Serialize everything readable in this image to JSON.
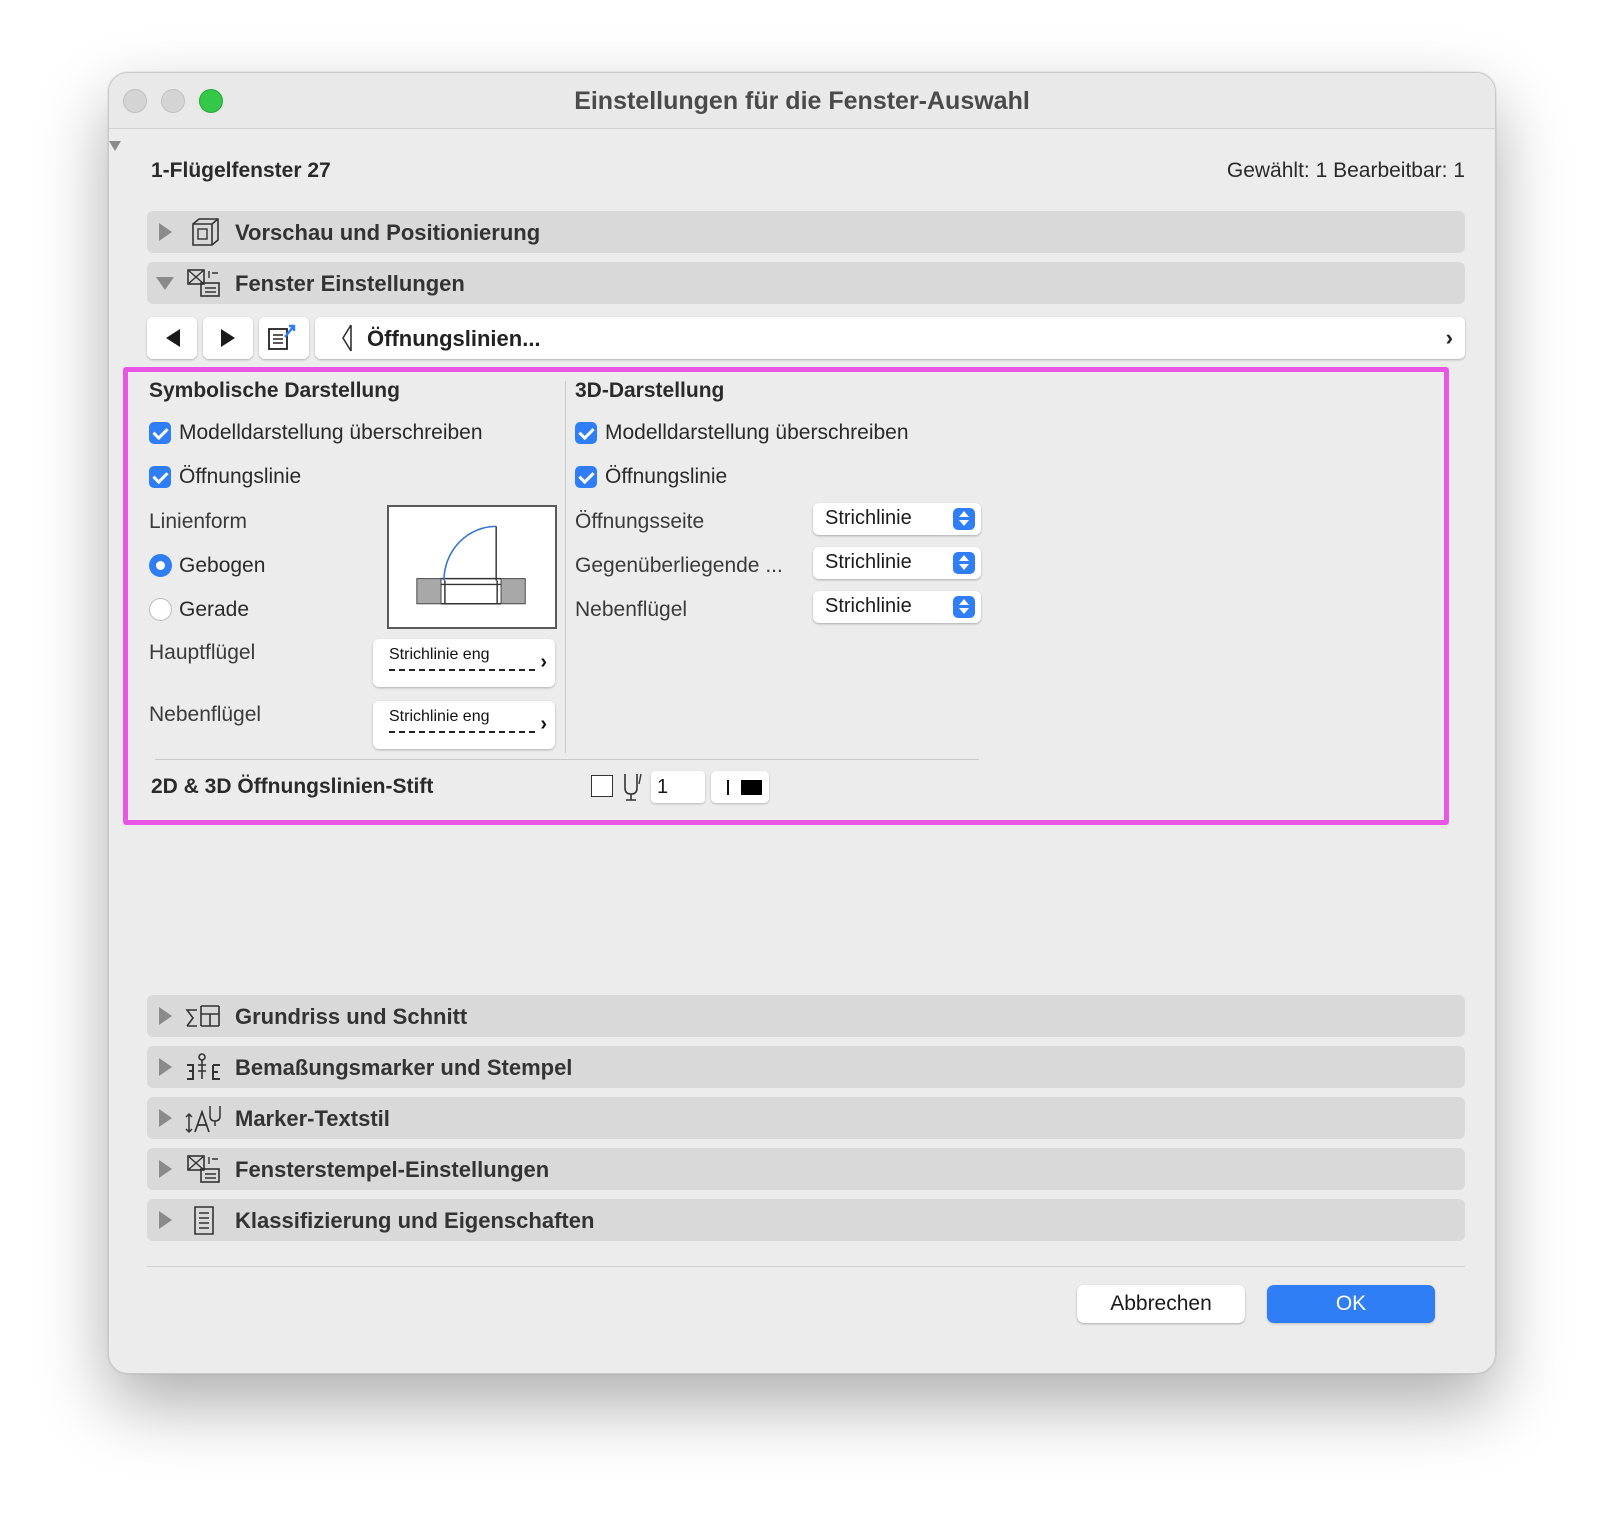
{
  "window": {
    "title": "Einstellungen für die Fenster-Auswahl",
    "element_name": "1-Flügelfenster 27",
    "selection_info": "Gewählt: 1 Bearbeitbar: 1"
  },
  "sections_top": [
    {
      "label": "Vorschau und Positionierung",
      "expanded": false,
      "icon": "preview-box-icon"
    },
    {
      "label": "Fenster Einstellungen",
      "expanded": true,
      "icon": "window-settings-icon"
    }
  ],
  "page_nav": {
    "current_page": "Öffnungslinien...",
    "page_icon": "opening-line-icon"
  },
  "symbolic": {
    "header": "Symbolische Darstellung",
    "override_label": "Modelldarstellung überschreiben",
    "override_checked": true,
    "opening_line_label": "Öffnungslinie",
    "opening_line_checked": true,
    "line_shape_label": "Linienform",
    "curved_label": "Gebogen",
    "curved_selected": true,
    "straight_label": "Gerade",
    "main_sash_label": "Hauptflügel",
    "main_sash_line": "Strichlinie eng",
    "side_sash_label": "Nebenflügel",
    "side_sash_line": "Strichlinie eng"
  },
  "three_d": {
    "header": "3D-Darstellung",
    "override_label": "Modelldarstellung überschreiben",
    "override_checked": true,
    "opening_line_label": "Öffnungslinie",
    "opening_line_checked": true,
    "rows": [
      {
        "label": "Öffnungsseite",
        "value": "Strichlinie"
      },
      {
        "label": "Gegenüberliegende ...",
        "value": "Strichlinie"
      },
      {
        "label": "Nebenflügel",
        "value": "Strichlinie"
      }
    ]
  },
  "pen": {
    "label": "2D & 3D Öffnungslinien-Stift",
    "value": "1",
    "color": "#000000"
  },
  "sections_bottom": [
    {
      "label": "Grundriss und Schnitt",
      "icon": "floor-plan-section-icon"
    },
    {
      "label": "Bemaßungsmarker und Stempel",
      "icon": "dimension-marker-icon"
    },
    {
      "label": "Marker-Textstil",
      "icon": "marker-text-style-icon"
    },
    {
      "label": "Fensterstempel-Einstellungen",
      "icon": "window-stamp-icon"
    },
    {
      "label": "Klassifizierung und Eigenschaften",
      "icon": "classification-icon"
    }
  ],
  "buttons": {
    "cancel": "Abbrechen",
    "ok": "OK"
  },
  "colors": {
    "accent": "#2f7ef6",
    "highlight": "#e857e3",
    "close_button": "#34c748"
  }
}
